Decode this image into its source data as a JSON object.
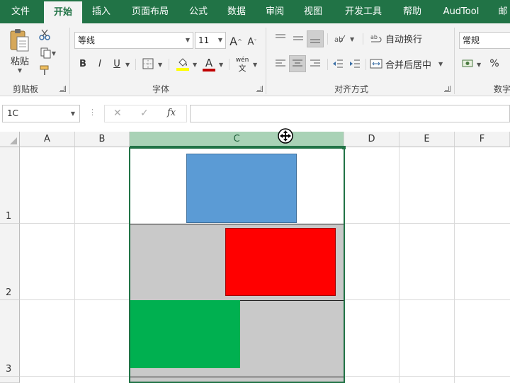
{
  "tabs": [
    "文件",
    "开始",
    "插入",
    "页面布局",
    "公式",
    "数据",
    "审阅",
    "视图",
    "开发工具",
    "帮助",
    "AudTool",
    "邮"
  ],
  "active_tab": "开始",
  "clipboard": {
    "paste_label": "粘贴",
    "group_label": "剪贴板"
  },
  "font": {
    "name": "等线",
    "size": "11",
    "grow_label": "A",
    "shrink_label": "A",
    "bold": "B",
    "italic": "I",
    "underline": "U",
    "fill_label": "◇",
    "color_label": "A",
    "phonetic_top": "wén",
    "phonetic_bottom": "文",
    "group_label": "字体",
    "fill_color": "#ffff00",
    "font_color": "#c00000"
  },
  "alignment": {
    "wrap_label": "自动换行",
    "merge_label": "合并后居中",
    "group_label": "对齐方式"
  },
  "number": {
    "format": "常规",
    "percent": "%",
    "group_label": "数字"
  },
  "formula_bar": {
    "name_box": "1C",
    "cancel": "✕",
    "enter": "✓",
    "fx": "fx",
    "formula": ""
  },
  "columns": [
    "A",
    "B",
    "C",
    "D",
    "E",
    "F"
  ],
  "rows": [
    "1",
    "2",
    "3"
  ],
  "selected_column": "C",
  "shapes": [
    {
      "row": 1,
      "color": "#5b9bd5",
      "name": "blue-rectangle"
    },
    {
      "row": 2,
      "color": "#ff0000",
      "name": "red-rectangle"
    },
    {
      "row": 3,
      "color": "#00b050",
      "name": "green-rectangle"
    }
  ],
  "colors": {
    "accent": "#217346",
    "cell_fill_gray": "#c9c9c9"
  }
}
